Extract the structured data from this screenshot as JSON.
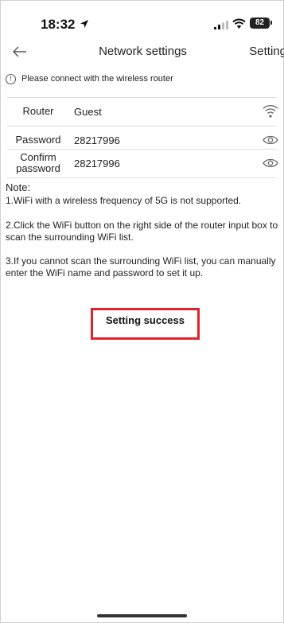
{
  "status_bar": {
    "time": "18:32",
    "battery": "82",
    "icons": [
      "location-arrow-icon",
      "cellular-signal-icon",
      "wifi-icon",
      "battery-icon"
    ]
  },
  "header": {
    "title": "Network settings",
    "settings_label": "Setting",
    "back_icon": "back-arrow-icon"
  },
  "notice": {
    "icon": "info-icon",
    "text": "Please connect with the wireless router"
  },
  "form": {
    "router": {
      "label": "Router",
      "value": "Guest",
      "icon": "wifi-scan-icon"
    },
    "password": {
      "label": "Password",
      "value": "28217996",
      "icon": "eye-icon"
    },
    "confirm": {
      "label_line1": "Confirm",
      "label_line2": "password",
      "value": "28217996",
      "icon": "eye-icon"
    }
  },
  "note": {
    "title": "Note:",
    "items": [
      "1.WiFi with a wireless frequency of 5G is not supported.",
      "2.Click the WiFi button on the right side of the router input box to scan the surrounding WiFi list.",
      "3.If you cannot scan the surrounding WiFi list, you can manually enter the WiFi name and password to set it up."
    ]
  },
  "result": {
    "message": "Setting success",
    "highlight_color": "#e0232a"
  }
}
